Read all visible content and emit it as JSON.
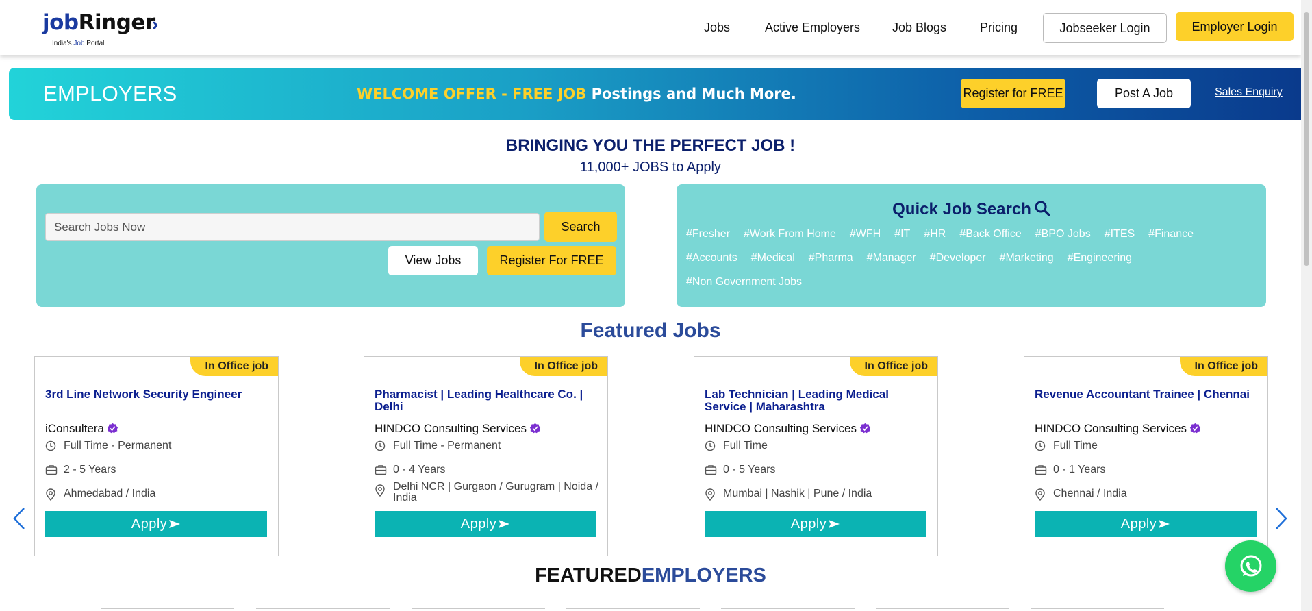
{
  "header": {
    "logo": {
      "word_job": "job",
      "word_ringer": "Ringer",
      "tagline_pre": "India's ",
      "tagline_hl": "Job",
      "tagline_post": " Portal"
    },
    "nav": [
      "Jobs",
      "Active Employers",
      "Job Blogs",
      "Pricing"
    ],
    "jobseeker_login": "Jobseeker Login",
    "employer_login": "Employer Login"
  },
  "banner": {
    "title": "EMPLOYERS",
    "offer_yellow": "WELCOME OFFER - FREE JOB",
    "offer_white": " Postings and Much More.",
    "register_label": "Register for FREE",
    "post_job_label": "Post A Job",
    "sales_enquiry": "Sales Enquiry"
  },
  "hero": {
    "title": "BRINGING YOU THE PERFECT JOB !",
    "subtitle": "11,000+ JOBS to Apply"
  },
  "search": {
    "placeholder": "Search Jobs Now",
    "search_label": "Search",
    "view_jobs_label": "View Jobs",
    "register_label": "Register For FREE"
  },
  "quick_search": {
    "title": "Quick Job Search",
    "tags": [
      "#Fresher",
      "#Work From Home",
      "#WFH",
      "#IT",
      "#HR",
      "#Back Office",
      "#BPO Jobs",
      "#ITES",
      "#Finance",
      "#Accounts",
      "#Medical",
      "#Pharma",
      "#Manager",
      "#Developer",
      "#Marketing",
      "#Engineering",
      "#Non Government Jobs"
    ]
  },
  "featured_jobs": {
    "title": "Featured Jobs",
    "cards": [
      {
        "badge": "In Office job",
        "title": "3rd Line Network Security Engineer",
        "company": "iConsultera",
        "type": "Full Time - Permanent",
        "experience": "2 - 5 Years",
        "location": "Ahmedabad / India",
        "apply": "Apply"
      },
      {
        "badge": "In Office job",
        "title": "Pharmacist | Leading Healthcare Co. | Delhi",
        "company": "HINDCO Consulting Services",
        "type": "Full Time - Permanent",
        "experience": "0 - 4 Years",
        "location": "Delhi NCR | Gurgaon / Gurugram | Noida / India",
        "apply": "Apply"
      },
      {
        "badge": "In Office job",
        "title": "Lab Technician | Leading Medical Service | Maharashtra",
        "company": "HINDCO Consulting Services",
        "type": "Full Time",
        "experience": "0 - 5 Years",
        "location": "Mumbai | Nashik | Pune / India",
        "apply": "Apply"
      },
      {
        "badge": "In Office job",
        "title": "Revenue Accountant Trainee | Chennai",
        "company": "HINDCO Consulting Services",
        "type": "Full Time",
        "experience": "0 - 1 Years",
        "location": "Chennai / India",
        "apply": "Apply"
      }
    ]
  },
  "featured_employers": {
    "title_a": "FEATURED",
    "title_b": "EMPLOYERS"
  },
  "colors": {
    "accent_yellow": "#fdd02a",
    "teal": "#0bb3b3",
    "panel": "#7ad7d5",
    "navy": "#0b1f6b"
  },
  "icons": [
    "search-icon",
    "clock-icon",
    "briefcase-icon",
    "location-pin-icon",
    "verified-badge-icon",
    "chevron-left-icon",
    "chevron-right-icon",
    "whatsapp-icon",
    "send-arrow-icon"
  ]
}
